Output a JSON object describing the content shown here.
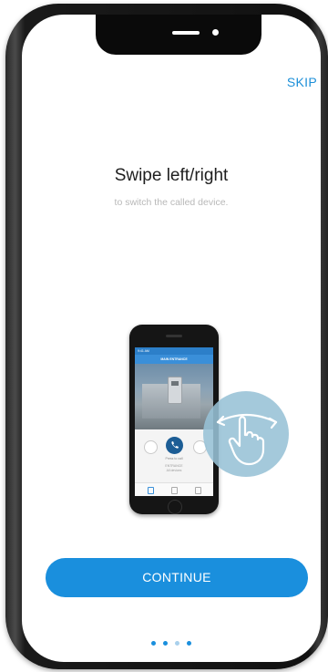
{
  "onboarding": {
    "skip_label": "SKIP",
    "title": "Swipe left/right",
    "subtitle": "to switch the called device.",
    "continue_label": "CONTINUE",
    "page_indicator": {
      "total": 4,
      "active_index": 1
    }
  },
  "illustration": {
    "screen_header": "MAIN ENTRANCE",
    "call_label": "Press to call",
    "status_time": "9:41 AM",
    "info_line1": "ENTRANCE",
    "info_line2": "All devices",
    "swipe_hint": "hand-swipe-icon"
  },
  "colors": {
    "accent": "#1a8fdd",
    "dot_inactive": "#a9d0ec",
    "swipe_circle": "#97c1d6",
    "title_text": "#1e1e1e",
    "subtitle_text": "#b8b8b8"
  }
}
